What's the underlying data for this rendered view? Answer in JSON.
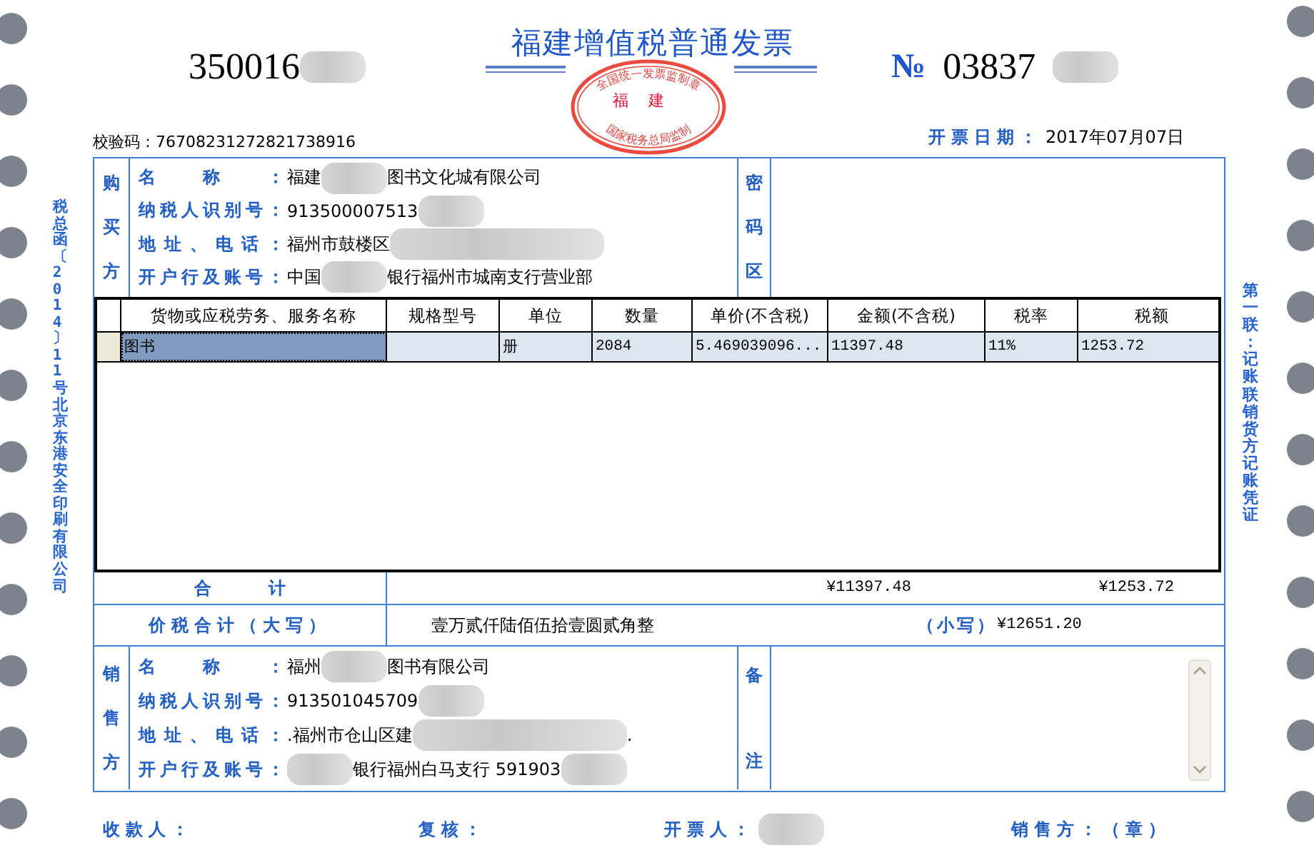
{
  "header": {
    "invoice_code": [
      {
        "kind": "text",
        "text": "350016"
      },
      {
        "kind": "blur"
      }
    ],
    "title": "福建增值税普通发票",
    "seal": {
      "top_text": "全国统一发票监制章",
      "center_text": "福建",
      "bottom_text": "国家税务总局监制"
    },
    "number_sign": "№",
    "number": [
      {
        "kind": "text",
        "text": "03837"
      },
      {
        "kind": "blur"
      }
    ],
    "check_code": {
      "label": "校验码：",
      "value": "76708231272821738916"
    },
    "issue_date": {
      "label": "开票日期：",
      "value": "2017年07月07日"
    }
  },
  "left_margin_text": "税总函〔2014〕11 号北京东港安全印刷有限公司",
  "right_margin_text": "第一联：记账联销货方记账凭证",
  "buyer": {
    "side_label": "购买方",
    "cipher_label": "密码区",
    "fields": [
      {
        "label": "名称：",
        "value": [
          {
            "kind": "text",
            "text": "福建"
          },
          {
            "kind": "blur"
          },
          {
            "kind": "text",
            "text": "图书文化城有限公司"
          }
        ]
      },
      {
        "label": "纳税人识别号：",
        "value": [
          {
            "kind": "text",
            "text": "913500007513"
          },
          {
            "kind": "blur"
          }
        ]
      },
      {
        "label": "地址、电话：",
        "value": [
          {
            "kind": "text",
            "text": "福州市鼓楼区"
          },
          {
            "kind": "long_blur"
          }
        ]
      },
      {
        "label": "开户行及账号：",
        "value": [
          {
            "kind": "text",
            "text": "中国"
          },
          {
            "kind": "blur"
          },
          {
            "kind": "text",
            "text": "银行福州市城南支行营业部"
          }
        ]
      }
    ]
  },
  "goods": {
    "columns": [
      "货物或应税劳务、服务名称",
      "规格型号",
      "单位",
      "数量",
      "单价(不含税)",
      "金额(不含税)",
      "税率",
      "税额"
    ],
    "rows": [
      {
        "selected": true,
        "cells": [
          {
            "text": "图书",
            "focused": true
          },
          {
            "focused": false
          },
          {
            "text": "册",
            "focused": false
          },
          {
            "text": "2084",
            "focused": false
          },
          {
            "text": "5.469039096...",
            "focused": false
          },
          {
            "text": "11397.48",
            "focused": false
          },
          {
            "text": "11%",
            "focused": false
          },
          {
            "text": "1253.72",
            "focused": false
          }
        ]
      }
    ]
  },
  "totals": {
    "label": "合计",
    "amount": "¥11397.48",
    "tax": "¥1253.72"
  },
  "grand_total": {
    "label": "价税合计（大写）",
    "words": "壹万贰仟陆佰伍拾壹圆贰角整",
    "small_label": "（小写）",
    "figure": "¥12651.20"
  },
  "seller": {
    "side_label": "销售方",
    "remark_label": "备注",
    "fields": [
      {
        "label": "名称：",
        "value": [
          {
            "kind": "text",
            "text": "福州"
          },
          {
            "kind": "blur"
          },
          {
            "kind": "text",
            "text": "图书有限公司"
          }
        ]
      },
      {
        "label": "纳税人识别号：",
        "value": [
          {
            "kind": "text",
            "text": "913501045709"
          },
          {
            "kind": "blur"
          }
        ]
      },
      {
        "label": "地址、电话：",
        "value": [
          {
            "kind": "text",
            "text": ".福州市仓山区建"
          },
          {
            "kind": "long_blur"
          },
          {
            "kind": "text",
            "text": "."
          }
        ]
      },
      {
        "label": "开户行及账号：",
        "value": [
          {
            "kind": "blur"
          },
          {
            "kind": "text",
            "text": "银行福州白马支行 591903"
          },
          {
            "kind": "blur"
          }
        ]
      }
    ]
  },
  "footer": [
    {
      "label": "收款人："
    },
    {
      "label": "复核："
    },
    {
      "label": "开票人：",
      "value": [
        {
          "kind": "blur"
        }
      ]
    },
    {
      "label": "销售方：（章）"
    }
  ]
}
